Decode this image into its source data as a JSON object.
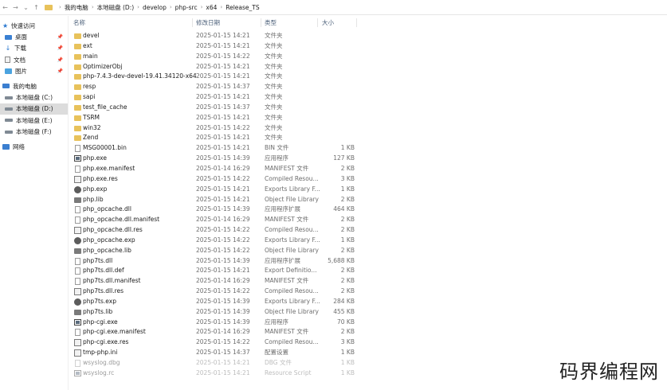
{
  "breadcrumb": [
    "我的电脑",
    "本地磁盘 (D:)",
    "develop",
    "php-src",
    "x64",
    "Release_TS"
  ],
  "sidebar": {
    "items": [
      {
        "label": "快速访问",
        "icon": "star-icon",
        "pinned": false
      },
      {
        "label": "桌面",
        "icon": "desktop-icon",
        "pinned": true
      },
      {
        "label": "下载",
        "icon": "download-icon",
        "pinned": true
      },
      {
        "label": "文档",
        "icon": "document-icon",
        "pinned": true
      },
      {
        "label": "图片",
        "icon": "picture-icon",
        "pinned": true
      },
      {
        "label": "我的电脑",
        "icon": "computer-icon",
        "pinned": false
      },
      {
        "label": "本地磁盘 (C:)",
        "icon": "drive-icon",
        "pinned": false
      },
      {
        "label": "本地磁盘 (D:)",
        "icon": "drive-icon",
        "pinned": false,
        "selected": true
      },
      {
        "label": "本地磁盘 (E:)",
        "icon": "drive-icon",
        "pinned": false
      },
      {
        "label": "本地磁盘 (F:)",
        "icon": "drive-icon",
        "pinned": false
      },
      {
        "label": "网络",
        "icon": "network-icon",
        "pinned": false
      }
    ]
  },
  "columns": {
    "name": "名称",
    "date": "修改日期",
    "type": "类型",
    "size": "大小"
  },
  "files": [
    {
      "name": "devel",
      "date": "2025-01-15 14:21",
      "type": "文件夹",
      "size": "",
      "icon": "folder-icon"
    },
    {
      "name": "ext",
      "date": "2025-01-15 14:21",
      "type": "文件夹",
      "size": "",
      "icon": "folder-icon"
    },
    {
      "name": "main",
      "date": "2025-01-15 14:22",
      "type": "文件夹",
      "size": "",
      "icon": "folder-icon"
    },
    {
      "name": "OptimizerObj",
      "date": "2025-01-15 14:21",
      "type": "文件夹",
      "size": "",
      "icon": "folder-icon"
    },
    {
      "name": "php-7.4.3-dev-devel-19.41.34120-x64",
      "date": "2025-01-15 14:21",
      "type": "文件夹",
      "size": "",
      "icon": "folder-icon"
    },
    {
      "name": "resp",
      "date": "2025-01-15 14:37",
      "type": "文件夹",
      "size": "",
      "icon": "folder-icon"
    },
    {
      "name": "sapi",
      "date": "2025-01-15 14:21",
      "type": "文件夹",
      "size": "",
      "icon": "folder-icon"
    },
    {
      "name": "test_file_cache",
      "date": "2025-01-15 14:37",
      "type": "文件夹",
      "size": "",
      "icon": "folder-icon"
    },
    {
      "name": "TSRM",
      "date": "2025-01-15 14:21",
      "type": "文件夹",
      "size": "",
      "icon": "folder-icon"
    },
    {
      "name": "win32",
      "date": "2025-01-15 14:22",
      "type": "文件夹",
      "size": "",
      "icon": "folder-icon"
    },
    {
      "name": "Zend",
      "date": "2025-01-15 14:21",
      "type": "文件夹",
      "size": "",
      "icon": "folder-icon"
    },
    {
      "name": "MSG00001.bin",
      "date": "2025-01-15 14:21",
      "type": "BIN 文件",
      "size": "1 KB",
      "icon": "file-icon"
    },
    {
      "name": "php.exe",
      "date": "2025-01-15 14:39",
      "type": "应用程序",
      "size": "127 KB",
      "icon": "exe-icon"
    },
    {
      "name": "php.exe.manifest",
      "date": "2025-01-14 16:29",
      "type": "MANIFEST 文件",
      "size": "2 KB",
      "icon": "file-icon"
    },
    {
      "name": "php.exe.res",
      "date": "2025-01-15 14:22",
      "type": "Compiled Resou...",
      "size": "3 KB",
      "icon": "config-icon"
    },
    {
      "name": "php.exp",
      "date": "2025-01-15 14:21",
      "type": "Exports Library F...",
      "size": "1 KB",
      "icon": "exp-icon"
    },
    {
      "name": "php.lib",
      "date": "2025-01-15 14:21",
      "type": "Object File Library",
      "size": "2 KB",
      "icon": "lib-icon"
    },
    {
      "name": "php_opcache.dll",
      "date": "2025-01-15 14:39",
      "type": "应用程序扩展",
      "size": "464 KB",
      "icon": "file-icon"
    },
    {
      "name": "php_opcache.dll.manifest",
      "date": "2025-01-14 16:29",
      "type": "MANIFEST 文件",
      "size": "2 KB",
      "icon": "file-icon"
    },
    {
      "name": "php_opcache.dll.res",
      "date": "2025-01-15 14:22",
      "type": "Compiled Resou...",
      "size": "2 KB",
      "icon": "config-icon"
    },
    {
      "name": "php_opcache.exp",
      "date": "2025-01-15 14:22",
      "type": "Exports Library F...",
      "size": "1 KB",
      "icon": "exp-icon"
    },
    {
      "name": "php_opcache.lib",
      "date": "2025-01-15 14:22",
      "type": "Object File Library",
      "size": "2 KB",
      "icon": "lib-icon"
    },
    {
      "name": "php7ts.dll",
      "date": "2025-01-15 14:39",
      "type": "应用程序扩展",
      "size": "5,688 KB",
      "icon": "file-icon"
    },
    {
      "name": "php7ts.dll.def",
      "date": "2025-01-15 14:21",
      "type": "Export Definitio...",
      "size": "2 KB",
      "icon": "file-icon"
    },
    {
      "name": "php7ts.dll.manifest",
      "date": "2025-01-14 16:29",
      "type": "MANIFEST 文件",
      "size": "2 KB",
      "icon": "file-icon"
    },
    {
      "name": "php7ts.dll.res",
      "date": "2025-01-15 14:22",
      "type": "Compiled Resou...",
      "size": "2 KB",
      "icon": "config-icon"
    },
    {
      "name": "php7ts.exp",
      "date": "2025-01-15 14:39",
      "type": "Exports Library F...",
      "size": "284 KB",
      "icon": "exp-icon"
    },
    {
      "name": "php7ts.lib",
      "date": "2025-01-15 14:39",
      "type": "Object File Library",
      "size": "455 KB",
      "icon": "lib-icon"
    },
    {
      "name": "php-cgi.exe",
      "date": "2025-01-15 14:39",
      "type": "应用程序",
      "size": "70 KB",
      "icon": "exe-icon"
    },
    {
      "name": "php-cgi.exe.manifest",
      "date": "2025-01-14 16:29",
      "type": "MANIFEST 文件",
      "size": "2 KB",
      "icon": "file-icon"
    },
    {
      "name": "php-cgi.exe.res",
      "date": "2025-01-15 14:22",
      "type": "Compiled Resou...",
      "size": "3 KB",
      "icon": "config-icon"
    },
    {
      "name": "tmp-php.ini",
      "date": "2025-01-15 14:37",
      "type": "配置设置",
      "size": "1 KB",
      "icon": "config-icon"
    },
    {
      "name": "wsyslog.dbg",
      "date": "2025-01-15 14:21",
      "type": "DBG 文件",
      "size": "1 KB",
      "icon": "file-icon",
      "dim": true
    },
    {
      "name": "wsyslog.rc",
      "date": "2025-01-15 14:21",
      "type": "Resource Script",
      "size": "1 KB",
      "icon": "exe-icon",
      "dim": true
    }
  ],
  "watermark": "码界编程网"
}
